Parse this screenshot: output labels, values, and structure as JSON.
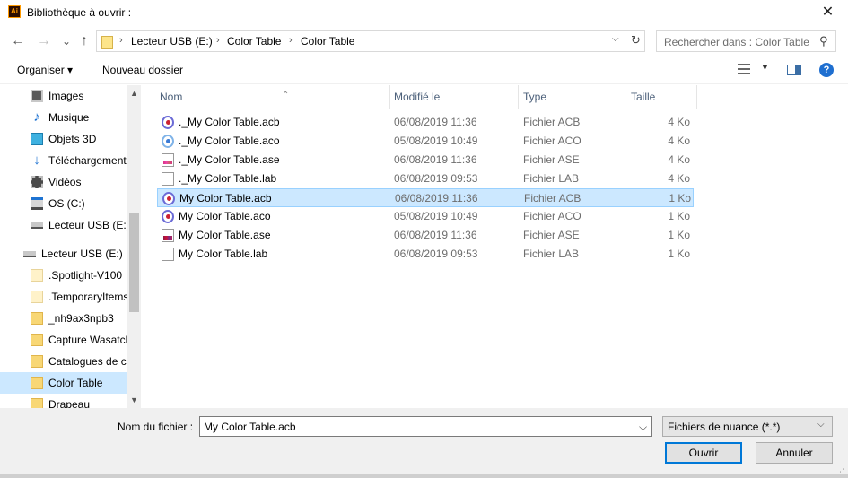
{
  "window": {
    "title": "Bibliothèque à ouvrir :",
    "app_icon_text": "Ai",
    "close_glyph": "✕"
  },
  "nav": {
    "back_glyph": "←",
    "forward_glyph": "→",
    "recent_glyph": "⌄",
    "up_glyph": "↑"
  },
  "address": {
    "crumbs": [
      "Lecteur USB (E:)",
      "Color Table",
      "Color Table"
    ],
    "separator": "›"
  },
  "search": {
    "placeholder": "Rechercher dans : Color Table"
  },
  "toolbar": {
    "organize_label": "Organiser ▾",
    "new_folder_label": "Nouveau dossier",
    "help_glyph": "?"
  },
  "sidebar": {
    "items": [
      {
        "label": "Images",
        "icon": "images-icon"
      },
      {
        "label": "Musique",
        "icon": "music-icon"
      },
      {
        "label": "Objets 3D",
        "icon": "objects-3d-icon"
      },
      {
        "label": "Téléchargements",
        "icon": "download-icon"
      },
      {
        "label": "Vidéos",
        "icon": "video-icon"
      },
      {
        "label": "OS (C:)",
        "icon": "drive-icon"
      },
      {
        "label": "Lecteur USB (E:)",
        "icon": "usb-drive-icon"
      },
      {
        "label": "Lecteur USB (E:)",
        "icon": "usb-drive-icon"
      },
      {
        "label": ".Spotlight-V100",
        "icon": "folder-icon"
      },
      {
        "label": ".TemporaryItems",
        "icon": "folder-icon"
      },
      {
        "label": "_nh9ax3npb3",
        "icon": "folder-icon"
      },
      {
        "label": "Capture Wasatch",
        "icon": "folder-icon"
      },
      {
        "label": "Catalogues de co",
        "icon": "folder-icon"
      },
      {
        "label": "Color Table",
        "icon": "folder-icon",
        "selected": true
      },
      {
        "label": "Drapeau",
        "icon": "folder-icon"
      }
    ]
  },
  "columns": {
    "name": "Nom",
    "modified": "Modifié le",
    "type": "Type",
    "size": "Taille"
  },
  "files": [
    {
      "name": "._My Color Table.acb",
      "modified": "06/08/2019 11:36",
      "type": "Fichier ACB",
      "size": "4 Ko",
      "icon": "acb-file-icon"
    },
    {
      "name": "._My Color Table.aco",
      "modified": "05/08/2019 10:49",
      "type": "Fichier ACO",
      "size": "4 Ko",
      "icon": "aco-file-icon"
    },
    {
      "name": "._My Color Table.ase",
      "modified": "06/08/2019 11:36",
      "type": "Fichier ASE",
      "size": "4 Ko",
      "icon": "ase-file-icon"
    },
    {
      "name": "._My Color Table.lab",
      "modified": "06/08/2019 09:53",
      "type": "Fichier LAB",
      "size": "4 Ko",
      "icon": "lab-file-icon"
    },
    {
      "name": "My Color Table.acb",
      "modified": "06/08/2019 11:36",
      "type": "Fichier ACB",
      "size": "1 Ko",
      "icon": "acb-file-icon",
      "selected": true
    },
    {
      "name": "My Color Table.aco",
      "modified": "05/08/2019 10:49",
      "type": "Fichier ACO",
      "size": "1 Ko",
      "icon": "aco-file-icon"
    },
    {
      "name": "My Color Table.ase",
      "modified": "06/08/2019 11:36",
      "type": "Fichier ASE",
      "size": "1 Ko",
      "icon": "ase-file-icon"
    },
    {
      "name": "My Color Table.lab",
      "modified": "06/08/2019 09:53",
      "type": "Fichier LAB",
      "size": "1 Ko",
      "icon": "lab-file-icon"
    }
  ],
  "footer": {
    "filename_label": "Nom du fichier :",
    "filename_value": "My Color Table.acb",
    "filetype_value": "Fichiers de nuance (*.*)",
    "open_label": "Ouvrir",
    "cancel_label": "Annuler"
  },
  "colors": {
    "selection": "#cce8ff",
    "accent": "#0078d7"
  }
}
